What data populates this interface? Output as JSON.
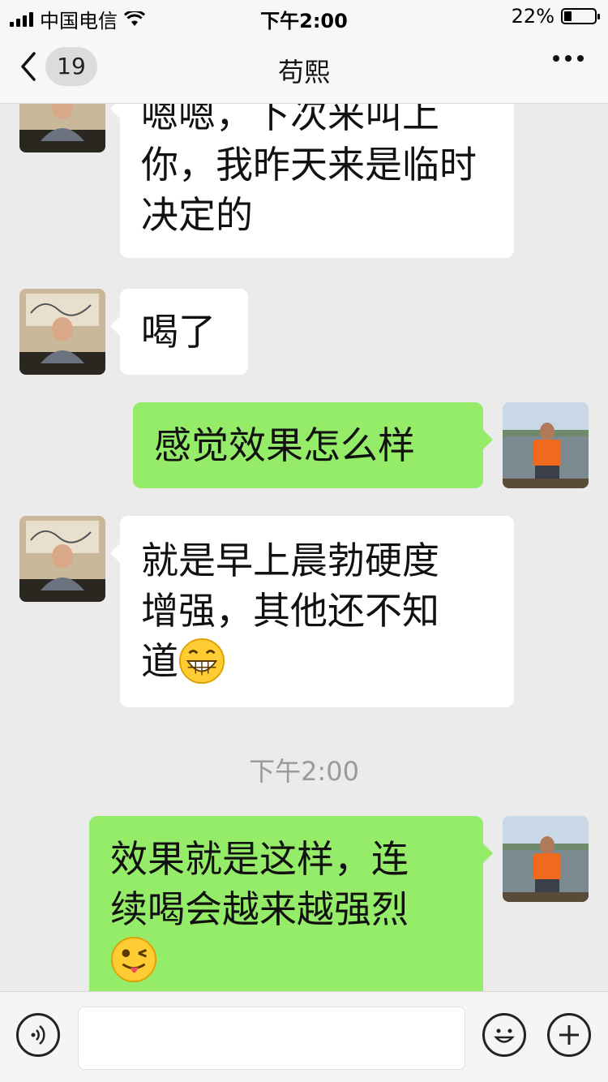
{
  "status_bar": {
    "carrier": "中国电信",
    "time": "下午2:00",
    "battery": "22%",
    "battery_level": 0.22
  },
  "nav": {
    "back_count": "19",
    "title": "苟熙"
  },
  "messages": [
    {
      "side": "in",
      "text": "嗯嗯，下次来叫上你，我昨天来是临时决定的"
    },
    {
      "side": "in",
      "text": "喝了"
    },
    {
      "side": "out",
      "text": "感觉效果怎么样"
    },
    {
      "side": "in",
      "line1": "就是早上晨勃硬度",
      "line2": "增强，其他还不知",
      "line3": "道",
      "emoji": "grinning-face-emoji"
    },
    {
      "side": "out",
      "line1": "效果就是这样，连",
      "line2": "续喝会越来越强烈",
      "emoji": "winking-tongue-face-emoji"
    }
  ],
  "timestamp": "下午2:00",
  "input": {
    "value": ""
  },
  "colors": {
    "outgoing_bubble": "#95ec69",
    "incoming_bubble": "#ffffff",
    "background": "#ebebeb"
  },
  "icons": [
    "back-chevron-icon",
    "more-icon",
    "voice-icon",
    "emoji-icon",
    "plus-icon",
    "wifi-icon",
    "signal-icon",
    "battery-icon"
  ]
}
